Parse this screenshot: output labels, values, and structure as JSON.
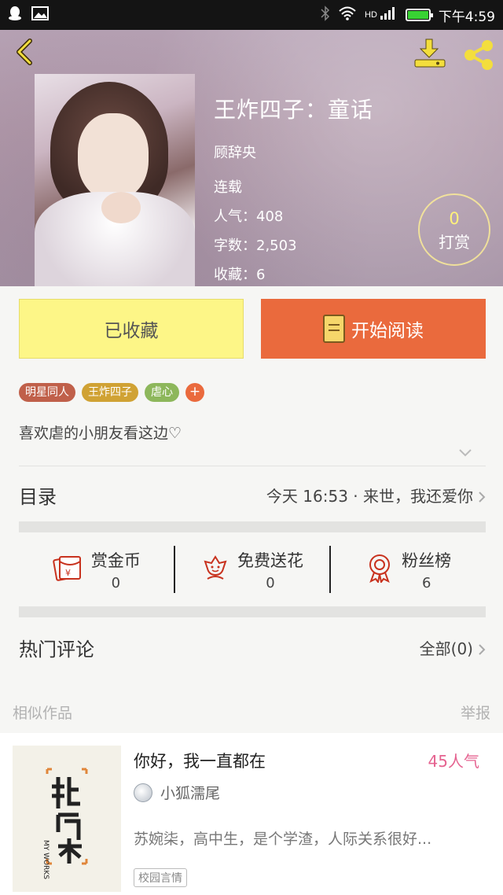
{
  "status_bar": {
    "time": "下午4:59",
    "battery_level": 0.92
  },
  "book": {
    "title": "王炸四子：童话",
    "author": "顾辞央",
    "status": "连载",
    "popularity": "人气：408",
    "word_count": "字数：2,503",
    "favorites": "收藏：6",
    "tip": {
      "count": "0",
      "label": "打赏"
    }
  },
  "actions": {
    "favorited_label": "已收藏",
    "read_label": "开始阅读"
  },
  "tags": [
    {
      "label": "明星同人",
      "color": "#c0604a"
    },
    {
      "label": "王炸四子",
      "color": "#d0a234"
    },
    {
      "label": "虐心",
      "color": "#8db75b"
    }
  ],
  "tag_add": "+",
  "description": "喜欢虐的小朋友看这边♡",
  "catalog": {
    "label": "目录",
    "latest": "今天 16:53 · 来世，我还爱你"
  },
  "stats": [
    {
      "label": "赏金币",
      "value": "0",
      "icon": "red-envelope-icon"
    },
    {
      "label": "免费送花",
      "value": "0",
      "icon": "flower-icon"
    },
    {
      "label": "粉丝榜",
      "value": "6",
      "icon": "medal-icon"
    }
  ],
  "comments": {
    "label": "热门评论",
    "all": "全部(0)"
  },
  "similar": {
    "label": "相似作品",
    "report": "举报"
  },
  "similar_book": {
    "title": "你好，我一直都在",
    "popularity": "45人气",
    "author": "小狐濡尾",
    "description": "苏婉柒，高中生，是个学渣，人际关系很好...",
    "tag": "校园言情",
    "cover_text": "MY WORKS"
  },
  "colors": {
    "accent": "#ea6a3d",
    "favorite_bg": "#fdf687",
    "popularity": "#e56390"
  }
}
